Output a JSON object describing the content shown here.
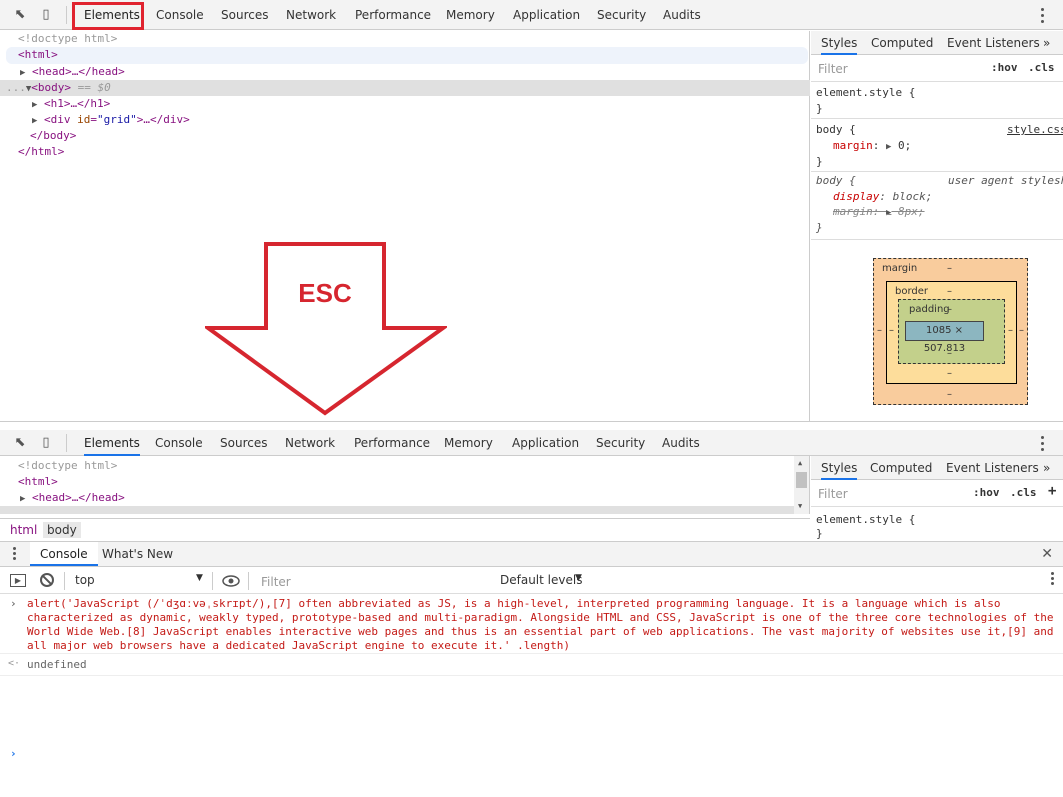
{
  "top_tabs": [
    "Elements",
    "Console",
    "Sources",
    "Network",
    "Performance",
    "Memory",
    "Application",
    "Security",
    "Audits"
  ],
  "dom_lines": {
    "doctype": "<!doctype html>",
    "html_open": "<html>",
    "head": "<head>…</head>",
    "body_open": "<body>",
    "body_marker": "== $0",
    "h1": "<h1>…</h1>",
    "div_tag": "<div ",
    "div_attr_name": "id",
    "div_attr_value": "\"grid\"",
    "div_end": ">…</div>",
    "body_close": "</body>",
    "html_close": "</html>",
    "ellipsis": "..."
  },
  "styles_pane": {
    "tabs": [
      "Styles",
      "Computed",
      "Event Listeners"
    ],
    "more": "»",
    "filter_placeholder": "Filter",
    "hov": ":hov",
    "cls": ".cls",
    "plus": "+",
    "element_style": "element.style {",
    "close_brace": "}",
    "rule1_selector": "body {",
    "rule1_source": "style.css",
    "rule1_prop": "margin",
    "rule1_value": "0;",
    "rule2_selector": "body {",
    "rule2_source": "user agent stylesheet",
    "rule2_prop1": "display",
    "rule2_value1": "block;",
    "rule2_prop2": "margin",
    "rule2_value2": "8px;"
  },
  "box_model": {
    "margin_label": "margin",
    "border_label": "border",
    "padding_label": "padding",
    "dash": "–",
    "content_size": "1085 × 507.813"
  },
  "annotation": {
    "esc_label": "ESC",
    "colour": "#d6262f"
  },
  "breadcrumbs": [
    "html",
    "body"
  ],
  "drawer": {
    "tabs": [
      "Console",
      "What's New"
    ],
    "context": "top",
    "filter_placeholder": "Filter",
    "levels": "Default levels"
  },
  "console": {
    "command": "alert('JavaScript (/ˈdʒɑːvəˌskrɪpt/),[7] often abbreviated as JS, is a high-level, interpreted programming language. It is a language which is also characterized as dynamic, weakly typed, prototype-based and multi-paradigm. Alongside HTML and CSS, JavaScript is one of the three core technologies of the World Wide Web.[8] JavaScript enables interactive web pages and thus is an essential part of web applications. The vast majority of websites use it,[9] and all major web browsers have a dedicated JavaScript engine to execute it.' .length)",
    "result": "undefined",
    "prompt": "›",
    "return_marker": "<·"
  },
  "colors": {
    "accent": "#1a73e8",
    "highlight": "#e0232f",
    "tag": "#881280"
  }
}
